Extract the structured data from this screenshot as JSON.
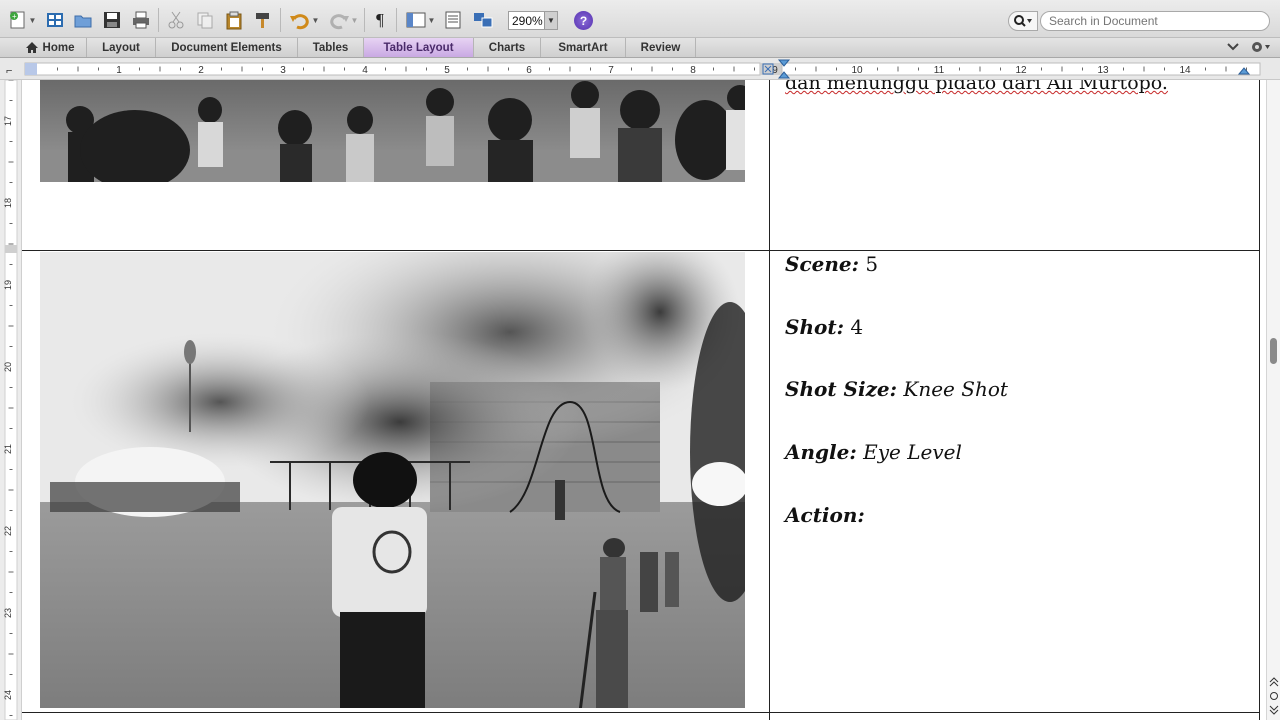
{
  "toolbar": {
    "zoom_value": "290%",
    "search_placeholder": "Search in Document",
    "help_label": "?",
    "pilcrow": "¶"
  },
  "ribbon": {
    "tabs": [
      {
        "label": "Home"
      },
      {
        "label": "Layout"
      },
      {
        "label": "Document Elements"
      },
      {
        "label": "Tables"
      },
      {
        "label": "Table Layout"
      },
      {
        "label": "Charts"
      },
      {
        "label": "SmartArt"
      },
      {
        "label": "Review"
      }
    ],
    "active_tab": "Table Layout",
    "active_color": "#d8bdec"
  },
  "ruler": {
    "h_labels": [
      "1",
      "2",
      "3",
      "4",
      "5",
      "6",
      "7",
      "8",
      "9",
      "10",
      "11",
      "12",
      "13",
      "14"
    ],
    "v_labels": [
      "17",
      "18",
      "19",
      "20",
      "21",
      "22",
      "23",
      "24"
    ]
  },
  "document": {
    "prev_row_text": "dan menunggu pidato dari Ali Murtopo.",
    "scene": {
      "label": "Scene:",
      "value": "5"
    },
    "shot": {
      "label": "Shot:",
      "value": "4"
    },
    "shot_size": {
      "label": "Shot Size:",
      "value": "Knee Shot"
    },
    "angle": {
      "label": "Angle:",
      "value": "Eye Level"
    },
    "action": {
      "label": "Action:",
      "value": ""
    }
  }
}
